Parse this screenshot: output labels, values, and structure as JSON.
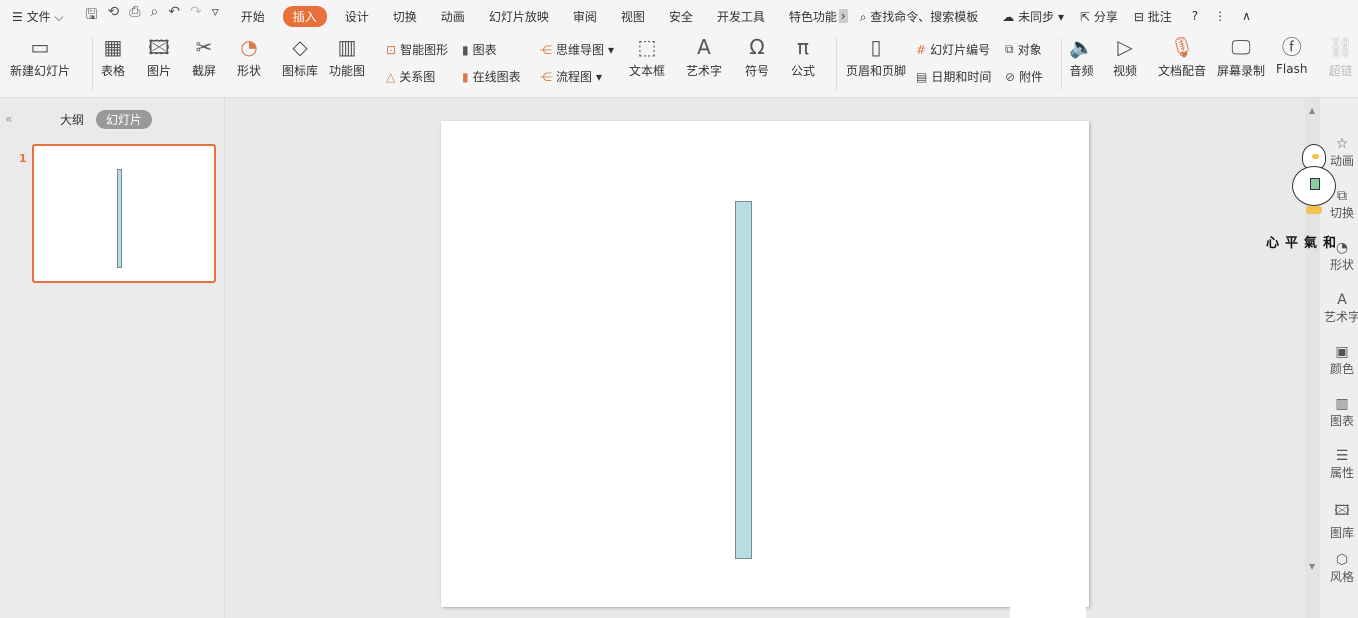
{
  "menubar": {
    "file": "文件",
    "tabs": [
      "开始",
      "插入",
      "设计",
      "切换",
      "动画",
      "幻灯片放映",
      "审阅",
      "视图",
      "安全",
      "开发工具",
      "特色功能"
    ],
    "active_tab": "插入",
    "search": "查找命令、搜索模板",
    "sync": "未同步",
    "share": "分享",
    "comment": "批注"
  },
  "ribbon": {
    "new_slide": "新建幻灯片",
    "table": "表格",
    "picture": "图片",
    "screenshot": "截屏",
    "shape": "形状",
    "icon_lib": "图标库",
    "function_chart": "功能图",
    "smart_art": "智能图形",
    "chart": "图表",
    "relation": "关系图",
    "online_chart": "在线图表",
    "mind_map": "思维导图",
    "flow_chart": "流程图",
    "textbox": "文本框",
    "word_art": "艺术字",
    "symbol": "符号",
    "formula": "公式",
    "header_footer": "页眉和页脚",
    "slide_number": "幻灯片编号",
    "object": "对象",
    "date_time": "日期和时间",
    "attachment": "附件",
    "audio": "音频",
    "video": "视频",
    "doc_voice": "文档配音",
    "screen_record": "屏幕录制",
    "flash": "Flash",
    "hyperlink": "超链"
  },
  "left_panel": {
    "outline_tab": "大纲",
    "slides_tab": "幻灯片",
    "slide_number": "1"
  },
  "slide": {
    "shape_fill": "#b7dde3"
  },
  "right_sidebar": [
    "动画",
    "切换",
    "形状",
    "艺术字",
    "颜色",
    "图表",
    "属性",
    "图库",
    "风格"
  ],
  "watermark": "心平氣和"
}
